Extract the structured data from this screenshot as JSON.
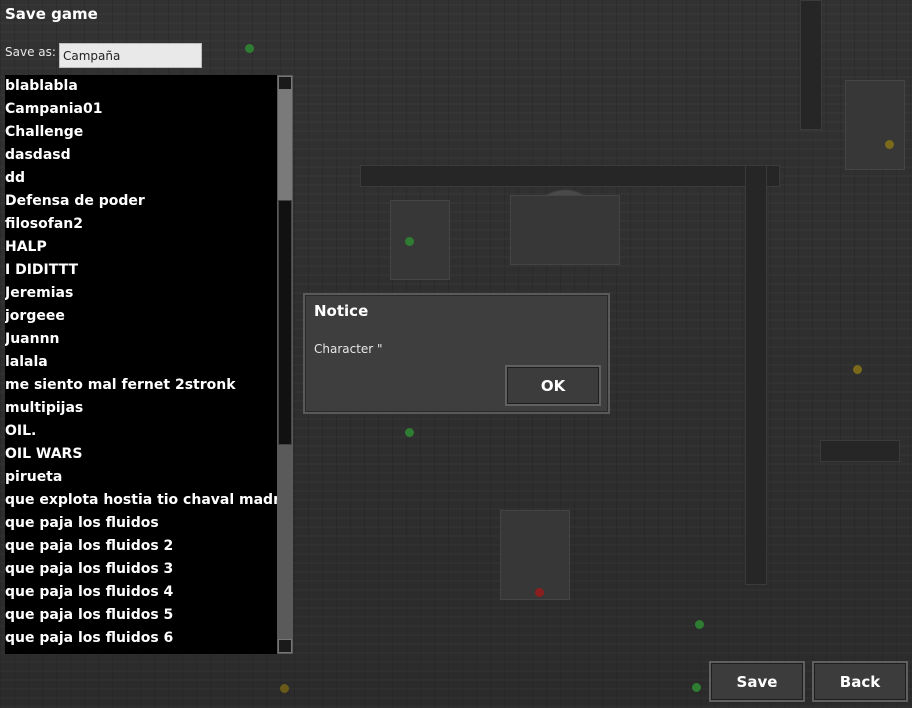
{
  "window": {
    "title": "Save game"
  },
  "save_as": {
    "label": "Save as:",
    "value": "Campaña"
  },
  "saves": [
    "blablabla",
    "Campania01",
    "Challenge",
    "dasdasd",
    "dd",
    "Defensa de poder",
    "filosofan2",
    "HALP",
    "I DIDITTT",
    "Jeremias",
    "jorgeee",
    "Juannn",
    "lalala",
    "me siento mal fernet 2stronk",
    "multipijas",
    "OIL.",
    "OIL WARS",
    "pirueta",
    "que explota hostia tio chaval madre mia",
    "que paja los fluidos",
    "que paja los fluidos 2",
    "que paja los fluidos 3",
    "que paja los fluidos 4",
    "que paja los fluidos 5",
    "que paja los fluidos 6"
  ],
  "dialog": {
    "title": "Notice",
    "message": "Character \"",
    "ok_label": "OK"
  },
  "buttons": {
    "save_label": "Save",
    "back_label": "Back"
  },
  "colors": {
    "list_bg": "#000000",
    "panel_bg": "#3e3e3e",
    "button_border": "#606060"
  }
}
